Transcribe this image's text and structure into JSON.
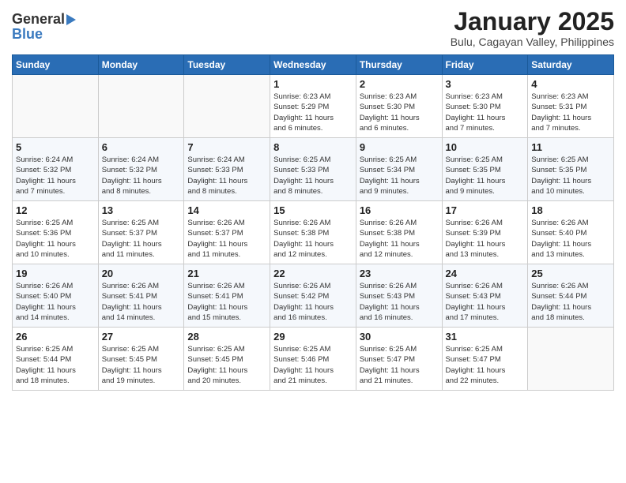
{
  "header": {
    "logo_general": "General",
    "logo_blue": "Blue",
    "title": "January 2025",
    "subtitle": "Bulu, Cagayan Valley, Philippines"
  },
  "days_of_week": [
    "Sunday",
    "Monday",
    "Tuesday",
    "Wednesday",
    "Thursday",
    "Friday",
    "Saturday"
  ],
  "weeks": [
    [
      {
        "day": "",
        "info": ""
      },
      {
        "day": "",
        "info": ""
      },
      {
        "day": "",
        "info": ""
      },
      {
        "day": "1",
        "info": "Sunrise: 6:23 AM\nSunset: 5:29 PM\nDaylight: 11 hours\nand 6 minutes."
      },
      {
        "day": "2",
        "info": "Sunrise: 6:23 AM\nSunset: 5:30 PM\nDaylight: 11 hours\nand 6 minutes."
      },
      {
        "day": "3",
        "info": "Sunrise: 6:23 AM\nSunset: 5:30 PM\nDaylight: 11 hours\nand 7 minutes."
      },
      {
        "day": "4",
        "info": "Sunrise: 6:23 AM\nSunset: 5:31 PM\nDaylight: 11 hours\nand 7 minutes."
      }
    ],
    [
      {
        "day": "5",
        "info": "Sunrise: 6:24 AM\nSunset: 5:32 PM\nDaylight: 11 hours\nand 7 minutes."
      },
      {
        "day": "6",
        "info": "Sunrise: 6:24 AM\nSunset: 5:32 PM\nDaylight: 11 hours\nand 8 minutes."
      },
      {
        "day": "7",
        "info": "Sunrise: 6:24 AM\nSunset: 5:33 PM\nDaylight: 11 hours\nand 8 minutes."
      },
      {
        "day": "8",
        "info": "Sunrise: 6:25 AM\nSunset: 5:33 PM\nDaylight: 11 hours\nand 8 minutes."
      },
      {
        "day": "9",
        "info": "Sunrise: 6:25 AM\nSunset: 5:34 PM\nDaylight: 11 hours\nand 9 minutes."
      },
      {
        "day": "10",
        "info": "Sunrise: 6:25 AM\nSunset: 5:35 PM\nDaylight: 11 hours\nand 9 minutes."
      },
      {
        "day": "11",
        "info": "Sunrise: 6:25 AM\nSunset: 5:35 PM\nDaylight: 11 hours\nand 10 minutes."
      }
    ],
    [
      {
        "day": "12",
        "info": "Sunrise: 6:25 AM\nSunset: 5:36 PM\nDaylight: 11 hours\nand 10 minutes."
      },
      {
        "day": "13",
        "info": "Sunrise: 6:25 AM\nSunset: 5:37 PM\nDaylight: 11 hours\nand 11 minutes."
      },
      {
        "day": "14",
        "info": "Sunrise: 6:26 AM\nSunset: 5:37 PM\nDaylight: 11 hours\nand 11 minutes."
      },
      {
        "day": "15",
        "info": "Sunrise: 6:26 AM\nSunset: 5:38 PM\nDaylight: 11 hours\nand 12 minutes."
      },
      {
        "day": "16",
        "info": "Sunrise: 6:26 AM\nSunset: 5:38 PM\nDaylight: 11 hours\nand 12 minutes."
      },
      {
        "day": "17",
        "info": "Sunrise: 6:26 AM\nSunset: 5:39 PM\nDaylight: 11 hours\nand 13 minutes."
      },
      {
        "day": "18",
        "info": "Sunrise: 6:26 AM\nSunset: 5:40 PM\nDaylight: 11 hours\nand 13 minutes."
      }
    ],
    [
      {
        "day": "19",
        "info": "Sunrise: 6:26 AM\nSunset: 5:40 PM\nDaylight: 11 hours\nand 14 minutes."
      },
      {
        "day": "20",
        "info": "Sunrise: 6:26 AM\nSunset: 5:41 PM\nDaylight: 11 hours\nand 14 minutes."
      },
      {
        "day": "21",
        "info": "Sunrise: 6:26 AM\nSunset: 5:41 PM\nDaylight: 11 hours\nand 15 minutes."
      },
      {
        "day": "22",
        "info": "Sunrise: 6:26 AM\nSunset: 5:42 PM\nDaylight: 11 hours\nand 16 minutes."
      },
      {
        "day": "23",
        "info": "Sunrise: 6:26 AM\nSunset: 5:43 PM\nDaylight: 11 hours\nand 16 minutes."
      },
      {
        "day": "24",
        "info": "Sunrise: 6:26 AM\nSunset: 5:43 PM\nDaylight: 11 hours\nand 17 minutes."
      },
      {
        "day": "25",
        "info": "Sunrise: 6:26 AM\nSunset: 5:44 PM\nDaylight: 11 hours\nand 18 minutes."
      }
    ],
    [
      {
        "day": "26",
        "info": "Sunrise: 6:25 AM\nSunset: 5:44 PM\nDaylight: 11 hours\nand 18 minutes."
      },
      {
        "day": "27",
        "info": "Sunrise: 6:25 AM\nSunset: 5:45 PM\nDaylight: 11 hours\nand 19 minutes."
      },
      {
        "day": "28",
        "info": "Sunrise: 6:25 AM\nSunset: 5:45 PM\nDaylight: 11 hours\nand 20 minutes."
      },
      {
        "day": "29",
        "info": "Sunrise: 6:25 AM\nSunset: 5:46 PM\nDaylight: 11 hours\nand 21 minutes."
      },
      {
        "day": "30",
        "info": "Sunrise: 6:25 AM\nSunset: 5:47 PM\nDaylight: 11 hours\nand 21 minutes."
      },
      {
        "day": "31",
        "info": "Sunrise: 6:25 AM\nSunset: 5:47 PM\nDaylight: 11 hours\nand 22 minutes."
      },
      {
        "day": "",
        "info": ""
      }
    ]
  ]
}
